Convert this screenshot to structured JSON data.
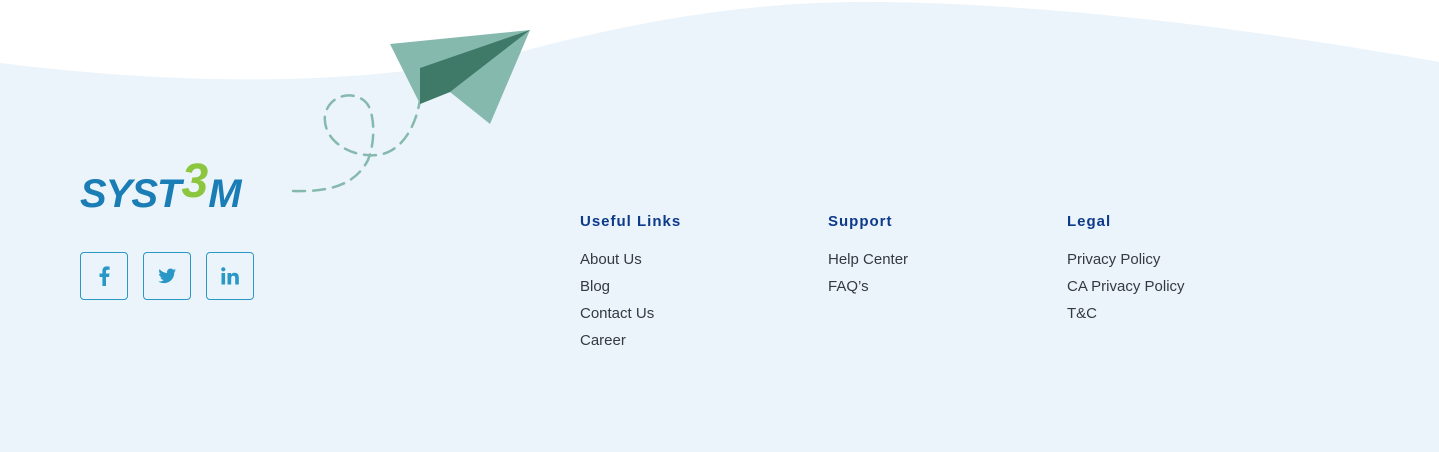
{
  "brand": {
    "logo_left": "SYST",
    "logo_mid": "3",
    "logo_right": "M",
    "primary_color": "#1a7db5",
    "accent_color": "#8cc63f"
  },
  "social": [
    {
      "name": "facebook",
      "icon": "facebook-icon"
    },
    {
      "name": "twitter",
      "icon": "twitter-icon"
    },
    {
      "name": "linkedin",
      "icon": "linkedin-icon"
    }
  ],
  "columns": {
    "useful_links": {
      "title": "Useful Links",
      "items": [
        "About Us",
        "Blog",
        "Contact Us",
        "Career"
      ]
    },
    "support": {
      "title": "Support",
      "items": [
        "Help Center",
        "FAQ’s"
      ]
    },
    "legal": {
      "title": "Legal",
      "items": [
        "Privacy Policy",
        "CA Privacy Policy",
        "T&C"
      ]
    }
  },
  "colors": {
    "background": "#ebf4fb",
    "heading": "#0e3a8a",
    "link": "#333a40",
    "plane_light": "#86b9ad",
    "plane_dark": "#3f7a69"
  }
}
